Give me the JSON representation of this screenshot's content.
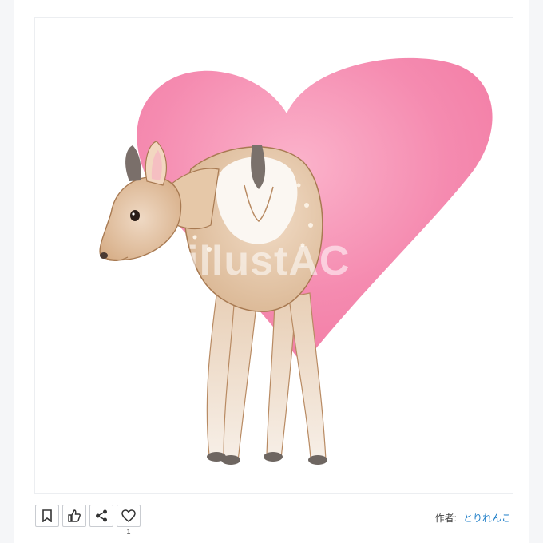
{
  "illustration": {
    "subject": "deer-rear-view-with-heart",
    "watermark": "illustAC",
    "colors": {
      "heart": "#f58bb0",
      "deer_fur": "#e3c3a2",
      "deer_outline": "#8a5a32",
      "hooves": "#6e6661"
    }
  },
  "actions": {
    "bookmark_icon": "bookmark-icon",
    "thumbs_up_icon": "thumbs-up-icon",
    "share_icon": "share-icon",
    "like_icon": "heart-icon",
    "like_count": "1"
  },
  "author": {
    "label": "作者:",
    "name": "とりれんこ"
  }
}
